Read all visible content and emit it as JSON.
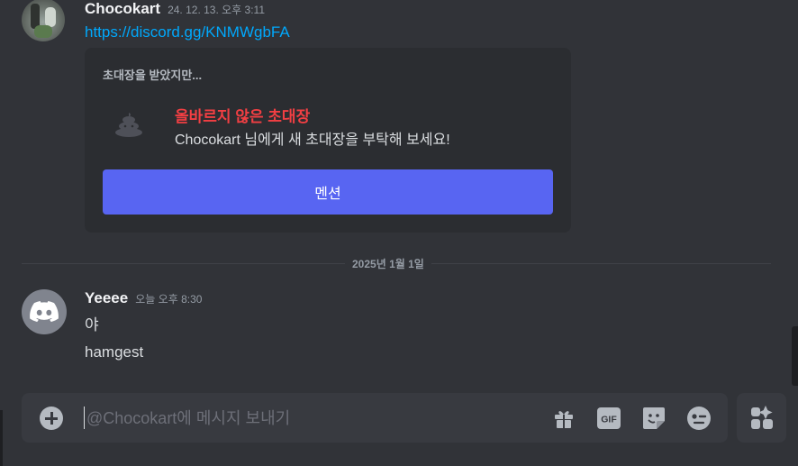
{
  "message1": {
    "author": "Chocokart",
    "timestamp": "24. 12. 13. 오후 3:11",
    "link": "https://discord.gg/KNMWgbFA",
    "invite": {
      "title": "초대장을 받았지만...",
      "heading": "올바르지 않은 초대장",
      "subtitle": "Chocokart 님에게 새 초대장을 부탁해 보세요!",
      "button_label": "멘션"
    }
  },
  "date_divider": "2025년 1월 1일",
  "message2": {
    "author": "Yeeee",
    "timestamp": "오늘 오후 8:30",
    "lines": [
      "야",
      "hamgest"
    ]
  },
  "composer": {
    "placeholder": "@Chocokart에 메시지 보내기",
    "value": "",
    "tools": [
      "gift-icon",
      "gif-icon",
      "sticker-icon",
      "emoji-icon"
    ],
    "gif_label": "GIF"
  },
  "colors": {
    "background": "#313338",
    "accent": "#5865f2",
    "link": "#00a8fc",
    "error": "#f23f43"
  }
}
